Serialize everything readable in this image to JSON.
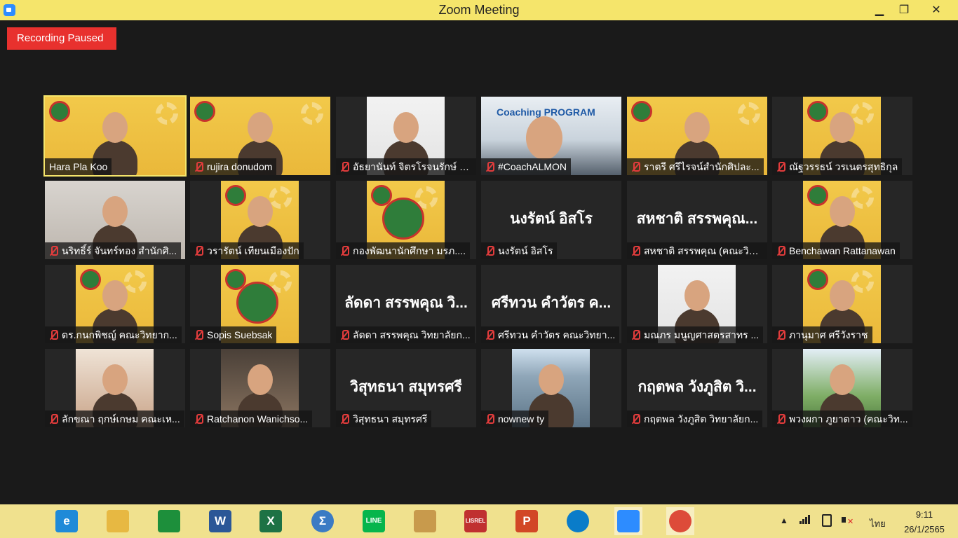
{
  "window": {
    "title": "Zoom Meeting",
    "controls": {
      "minimize": "▁",
      "maximize": "❐",
      "close": "✕"
    }
  },
  "recording": {
    "label": "Recording Paused",
    "color": "#e8312e"
  },
  "participants": [
    {
      "name": "Hara Pla Koo",
      "muted": false,
      "active_speaker": true,
      "video": "yellow-bg-person"
    },
    {
      "name": "rujira donudom",
      "muted": true,
      "video": "yellow-bg-person"
    },
    {
      "name": "อัธยานันท์ จิตรโรจนรักษ์ ค...",
      "muted": true,
      "video": "white-bg-person"
    },
    {
      "name": "#CoachALMON",
      "muted": true,
      "video": "coaching-program",
      "overlay_text": "Coaching PROGRAM"
    },
    {
      "name": "ราตรี   ศรีไรจน์สำนักศิปละ...",
      "muted": true,
      "video": "yellow-bg-person"
    },
    {
      "name": "ณัฐวรรธน์ วรเนตรสุทธิกุล",
      "muted": true,
      "video": "yellow-bg-person"
    },
    {
      "name": "นริทธิ์ร์ จันทร์ทอง สำนักศิ...",
      "muted": true,
      "video": "masked-person"
    },
    {
      "name": "วรารัตน์ เทียนเมืองปัก",
      "muted": true,
      "video": "yellow-bg-person"
    },
    {
      "name": "กองพัฒนานักศึกษา มรภ....",
      "muted": true,
      "video": "yellow-logo"
    },
    {
      "name": "นงรัตน์ อิสโร",
      "muted": true,
      "video": "name-only",
      "big_name": "นงรัตน์ อิสโร"
    },
    {
      "name": "สหชาติ สรรพคุณ (คณะวิท...",
      "muted": true,
      "video": "name-only",
      "big_name": "สหชาติ สรรพคุณ..."
    },
    {
      "name": "Benchawan Rattanawan",
      "muted": true,
      "video": "yellow-bg-person"
    },
    {
      "name": "ดร.กนกพิชญ์ คณะวิทยาก...",
      "muted": true,
      "video": "yellow-bg-person"
    },
    {
      "name": "Sopis Suebsak",
      "muted": true,
      "video": "yellow-logo"
    },
    {
      "name": "ลัดดา สรรพคุณ วิทยาลัยก...",
      "muted": true,
      "video": "name-only",
      "big_name": "ลัดดา สรรพคุณ วิ..."
    },
    {
      "name": "ศรีทวน  คำวัตร คณะวิทยา...",
      "muted": true,
      "video": "name-only",
      "big_name": "ศรีทวน  คำวัตร ค..."
    },
    {
      "name": "มณภร มนูญศาสตรสาทร ...",
      "muted": true,
      "video": "white-bg-person"
    },
    {
      "name": "ภานุมาศ ศรีวังราช",
      "muted": true,
      "video": "yellow-bg-person"
    },
    {
      "name": "ลักขณา ฤกษ์เกษม คณะเห...",
      "muted": true,
      "video": "pink-hat-person"
    },
    {
      "name": "Ratchanon Wanichso...",
      "muted": true,
      "video": "restaurant-person"
    },
    {
      "name": "วิสุทธนา สมุทรศรี",
      "muted": true,
      "video": "name-only",
      "big_name": "วิสุทธนา สมุทรศรี"
    },
    {
      "name": "nownew ty",
      "muted": true,
      "video": "lake-person"
    },
    {
      "name": "กฤตพล วังภูสิต วิทยาลัยก...",
      "muted": true,
      "video": "name-only",
      "big_name": "กฤตพล วังภูสิต วิ..."
    },
    {
      "name": "พวงผกา ภูยาดาว (คณะวิท...",
      "muted": true,
      "video": "outdoor-person"
    }
  ],
  "taskbar": {
    "items": [
      {
        "icon": "windows-start-icon",
        "label": "",
        "color": "#1e1e1e"
      },
      {
        "icon": "internet-explorer-icon",
        "label": "e",
        "color": "#1f8ad8"
      },
      {
        "icon": "file-explorer-icon",
        "label": "",
        "color": "#e7b842"
      },
      {
        "icon": "store-icon",
        "label": "",
        "color": "#1d8f3b"
      },
      {
        "icon": "word-icon",
        "label": "W",
        "color": "#2b5797"
      },
      {
        "icon": "excel-icon",
        "label": "X",
        "color": "#1d7245"
      },
      {
        "icon": "math-icon",
        "label": "Σ",
        "color": "#3b7bc4"
      },
      {
        "icon": "line-icon",
        "label": "LINE",
        "color": "#06b54c"
      },
      {
        "icon": "paint-icon",
        "label": "",
        "color": "#c89a4c"
      },
      {
        "icon": "lisrel-icon",
        "label": "LISREL",
        "color": "#c03030"
      },
      {
        "icon": "powerpoint-icon",
        "label": "P",
        "color": "#d24726"
      },
      {
        "icon": "edge-icon",
        "label": "",
        "color": "#0a7cc9"
      },
      {
        "icon": "zoom-icon",
        "label": "",
        "color": "#2d8cff"
      },
      {
        "icon": "chrome-icon",
        "label": "",
        "color": "#dd4b39"
      }
    ],
    "tray": {
      "language": "ไทย",
      "time": "9:11",
      "date": "26/1/2565"
    }
  }
}
